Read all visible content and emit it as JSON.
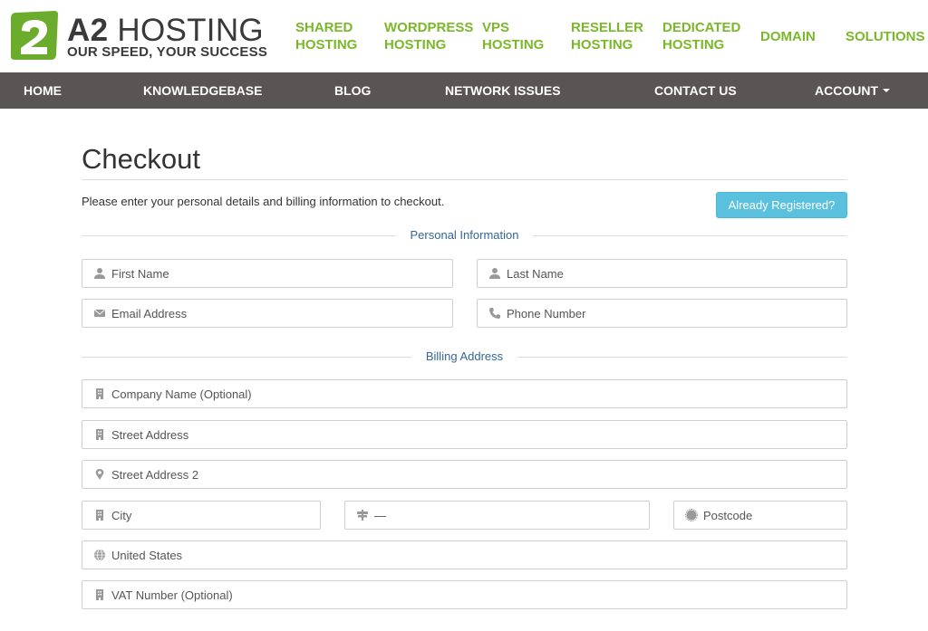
{
  "brand": {
    "name_bold": "A2",
    "name_rest": " HOSTING",
    "tagline": "OUR SPEED, YOUR SUCCESS",
    "color_green": "#7ab829",
    "color_dark": "#3a3a3a"
  },
  "topnav": [
    {
      "line1": "SHARED",
      "line2": "HOSTING"
    },
    {
      "line1": "WORDPRESS",
      "line2": "HOSTING"
    },
    {
      "line1": "VPS",
      "line2": "HOSTING"
    },
    {
      "line1": "RESELLER",
      "line2": "HOSTING"
    },
    {
      "line1": "DEDICATED",
      "line2": "HOSTING"
    },
    {
      "line1": "DOMAIN",
      "line2": ""
    },
    {
      "line1": "SOLUTIONS",
      "line2": ""
    }
  ],
  "mainnav": {
    "home": "HOME",
    "knowledgebase": "KNOWLEDGEBASE",
    "blog": "BLOG",
    "network_issues": "NETWORK ISSUES",
    "contact_us": "CONTACT US",
    "account": "ACCOUNT"
  },
  "checkout": {
    "title": "Checkout",
    "intro": "Please enter your personal details and billing information to checkout.",
    "already_registered": "Already Registered?"
  },
  "personal": {
    "heading": "Personal Information",
    "first_name": {
      "placeholder": "First Name",
      "icon": "user-icon"
    },
    "last_name": {
      "placeholder": "Last Name",
      "icon": "user-icon"
    },
    "email": {
      "placeholder": "Email Address",
      "icon": "envelope-icon"
    },
    "phone": {
      "placeholder": "Phone Number",
      "icon": "phone-icon"
    }
  },
  "billing": {
    "heading": "Billing Address",
    "company": {
      "placeholder": "Company Name (Optional)",
      "icon": "building-icon"
    },
    "street": {
      "placeholder": "Street Address",
      "icon": "building-icon"
    },
    "street2": {
      "placeholder": "Street Address 2",
      "icon": "map-marker-icon"
    },
    "city": {
      "placeholder": "City",
      "icon": "building-icon"
    },
    "state": {
      "value": "—",
      "icon": "signpost-icon"
    },
    "postcode": {
      "placeholder": "Postcode",
      "icon": "certificate-icon"
    },
    "country": {
      "value": "United States",
      "icon": "globe-icon"
    },
    "vat": {
      "placeholder": "VAT Number (Optional)",
      "icon": "building-icon"
    }
  },
  "colors": {
    "navbar_bg": "#595554",
    "info_button": "#5bc0de",
    "section_heading": "#336699"
  }
}
